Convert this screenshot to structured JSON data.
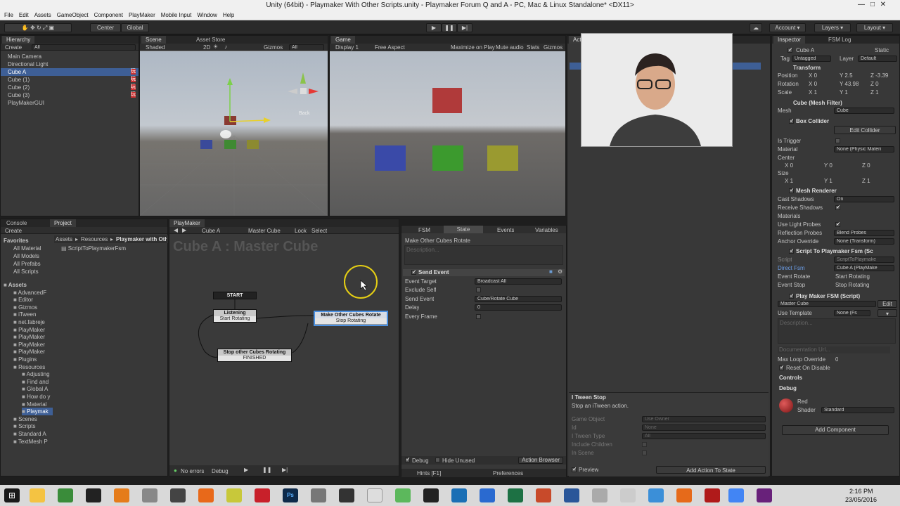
{
  "window": {
    "title": "Unity (64bit) - Playmaker With Other Scripts.unity - Playmaker Forum Q and A - PC, Mac & Linux Standalone* <DX11>"
  },
  "menu": [
    "File",
    "Edit",
    "Assets",
    "GameObject",
    "Component",
    "PlayMaker",
    "Mobile Input",
    "Window",
    "Help"
  ],
  "toolbar": {
    "pivot": "Center",
    "space": "Global",
    "account": "Account",
    "layers": "Layers",
    "layout": "Layout"
  },
  "hierarchy": {
    "tab": "Hierarchy",
    "create": "Create",
    "search": "All",
    "items": [
      "Main Camera",
      "Directional Light",
      "Cube A",
      "Cube (1)",
      "Cube (2)",
      "Cube (3)",
      "PlayMakerGUI"
    ],
    "selected": "Cube A"
  },
  "scene": {
    "tab": "Scene",
    "asset_store": "Asset Store",
    "shaded": "Shaded",
    "mode2d": "2D",
    "gizmos": "Gizmos",
    "search": "All",
    "back": "Back"
  },
  "game": {
    "tab": "Game",
    "display": "Display 1",
    "aspect": "Free Aspect",
    "maximize": "Maximize on Play",
    "mute": "Mute audio",
    "stats": "Stats",
    "gizmos": "Gizmos"
  },
  "actions_tab": "Actio",
  "console": {
    "tab": "Console",
    "project_tab": "Project",
    "create": "Create",
    "breadcrumb": [
      "Assets",
      "Resources",
      "Playmaker with Other Scripts"
    ],
    "file": "ScriptToPlaymakerFsm",
    "favorites": [
      "Favorites",
      "All Material",
      "All Models",
      "All Prefabs",
      "All Scripts"
    ],
    "assets": [
      "Assets",
      "AdvancedF",
      "Editor",
      "Gizmos",
      "iTween",
      "net.fabreje",
      "PlayMaker",
      "PlayMaker",
      "PlayMaker",
      "PlayMaker",
      "Plugins",
      "Resources",
      "Adjusting",
      "Find and",
      "Global A",
      "How do y",
      "Material",
      "Playmak",
      "Scenes",
      "Scripts",
      "Standard A",
      "TextMesh P"
    ]
  },
  "playmaker": {
    "tab": "PlayMaker",
    "object": "Cube A",
    "fsm": "Master Cube",
    "lock": "Lock",
    "select": "Select",
    "title": "Cube A : Master Cube",
    "states": [
      {
        "name": "START",
        "event": ""
      },
      {
        "name": "Listening",
        "event": "Start Rotating"
      },
      {
        "name": "Make Other Cubes Rotate",
        "event": "Stop Rotating"
      },
      {
        "name": "Stop other Cubes Rotating",
        "event": "FINISHED"
      }
    ],
    "status": "No errors",
    "debug": "Debug",
    "tabs": [
      "FSM",
      "State",
      "Events",
      "Variables"
    ],
    "state_name": "Make Other Cubes Rotate",
    "description": "Description...",
    "action": {
      "name": "Send Event",
      "fields": [
        {
          "label": "Event Target",
          "value": "Broadcast All"
        },
        {
          "label": "Exclude Self",
          "value": ""
        },
        {
          "label": "Send Event",
          "value": "Cube/Rotate Cube"
        },
        {
          "label": "Delay",
          "value": "0"
        },
        {
          "label": "Every Frame",
          "value": ""
        }
      ]
    },
    "debug_chk": "Debug",
    "hide_unused": "Hide Unused",
    "action_browser": "Action Browser",
    "hints": "Hints [F1]",
    "preferences": "Preferences"
  },
  "action_browser": {
    "title": "I Tween Stop",
    "desc": "Stop an iTween action.",
    "fields": [
      {
        "label": "Game Object",
        "value": "Use Owner"
      },
      {
        "label": "Id",
        "value": "None"
      },
      {
        "label": "I Tween Type",
        "value": "All"
      },
      {
        "label": "Include Children",
        "value": ""
      },
      {
        "label": "In Scene",
        "value": ""
      }
    ],
    "preview": "Preview",
    "add": "Add Action To State"
  },
  "inspector": {
    "tab": "Inspector",
    "fsm_log": "FSM Log",
    "name": "Cube A",
    "static": "Static",
    "tag": "Untagged",
    "layer": "Default",
    "transform": {
      "title": "Transform",
      "position": [
        "0",
        "2.5",
        "-3.39"
      ],
      "rotation": [
        "0",
        "43.98",
        "0"
      ],
      "scale": [
        "1",
        "1",
        "1"
      ]
    },
    "mesh_filter": {
      "title": "Cube (Mesh Filter)",
      "mesh": "Cube"
    },
    "box_collider": {
      "title": "Box Collider",
      "edit": "Edit Collider",
      "material": "None (Physic Materi",
      "center": [
        "0",
        "0",
        "0"
      ],
      "size": [
        "1",
        "1",
        "1"
      ]
    },
    "mesh_renderer": {
      "title": "Mesh Renderer",
      "cast_shadows": "On",
      "reflection": "Blend Probes",
      "anchor": "None (Transform)"
    },
    "script_fsm": {
      "title": "Script To Playmaker Fsm (Sc",
      "script": "ScriptToPlaymake",
      "direct_fsm": "Cube A (PlayMake",
      "event_rotate": "Start Rotating",
      "event_stop": "Stop Rotating"
    },
    "playmaker_fsm": {
      "title": "Play Maker FSM (Script)",
      "master": "Master Cube",
      "edit": "Edit",
      "template": "None (Fs",
      "description": "Description...",
      "doc_url": "Documentation Url...",
      "max_loop": "0",
      "reset": "Reset On Disable"
    },
    "controls": "Controls",
    "debug": "Debug",
    "material": "Red",
    "shader": "Standard",
    "add_component": "Add Component"
  },
  "clock": {
    "time": "2:16 PM",
    "date": "23/05/2016"
  }
}
